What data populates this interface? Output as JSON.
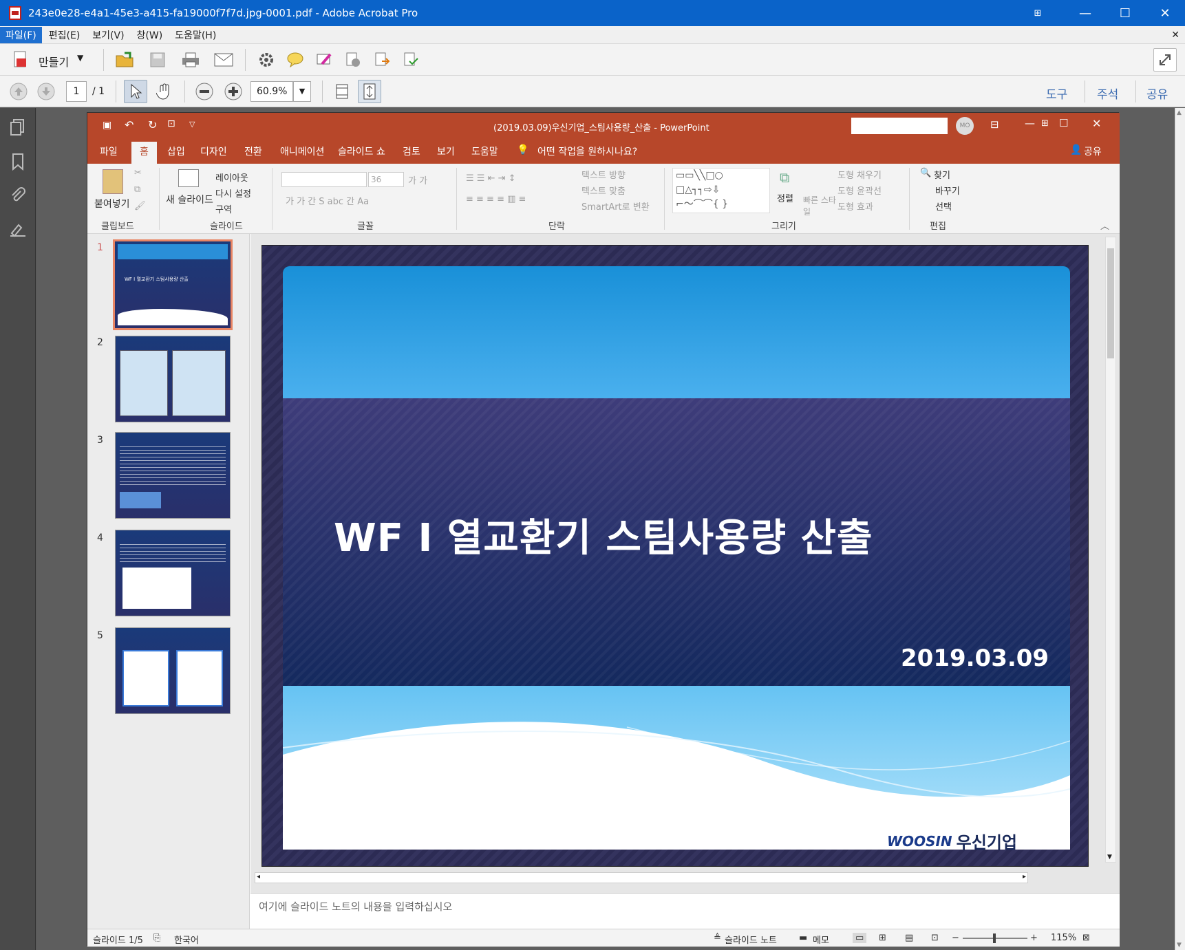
{
  "acrobat": {
    "title": "243e0e28-e4a1-45e3-a415-fa19000f7f7d.jpg-0001.pdf - Adobe Acrobat Pro",
    "menu": [
      "파일(F)",
      "편집(E)",
      "보기(V)",
      "창(W)",
      "도움말(H)"
    ],
    "create_label": "만들기",
    "page_current": "1",
    "page_total": "/ 1",
    "zoom": "60.9%",
    "right_tabs": [
      "도구",
      "주석",
      "공유"
    ]
  },
  "ppt": {
    "title": "(2019.03.09)우신기업_스팀사용량_산출  -  PowerPoint",
    "user_initials": "MO",
    "tabs": [
      "파일",
      "홈",
      "삽입",
      "디자인",
      "전환",
      "애니메이션",
      "슬라이드 쇼",
      "검토",
      "보기",
      "도움말"
    ],
    "tell_me": "어떤 작업을 원하시나요?",
    "share": "공유",
    "ribbon": {
      "clipboard": {
        "paste": "붙여넣기",
        "label": "클립보드"
      },
      "slides": {
        "new_slide": "새 슬라이드",
        "layout": "레이아웃",
        "reset": "다시 설정",
        "section": "구역",
        "label": "슬라이드"
      },
      "font": {
        "size": "36",
        "label": "글꼴"
      },
      "paragraph": {
        "text_dir": "텍스트 방향",
        "align_text": "텍스트 맞춤",
        "smartart": "SmartArt로 변환",
        "label": "단락"
      },
      "drawing": {
        "arrange": "정렬",
        "quick_styles": "빠른 스타일",
        "fill": "도형 채우기",
        "outline": "도형 윤곽선",
        "effects": "도형 효과",
        "label": "그리기"
      },
      "editing": {
        "find": "찾기",
        "replace": "바꾸기",
        "select": "선택",
        "label": "편집"
      }
    },
    "thumb_numbers": [
      "1",
      "2",
      "3",
      "4",
      "5"
    ],
    "slide": {
      "title": "WF I 열교환기 스팀사용량 산출",
      "date": "2019.03.09",
      "logo_en": "WOOSIN",
      "logo_kr": "우신기업"
    },
    "notes_placeholder": "여기에 슬라이드 노트의 내용을 입력하십시오",
    "status": {
      "slide": "슬라이드 1/5",
      "lang": "한국어",
      "notes": "슬라이드 노트",
      "comments": "메모",
      "zoom": "115%"
    }
  }
}
